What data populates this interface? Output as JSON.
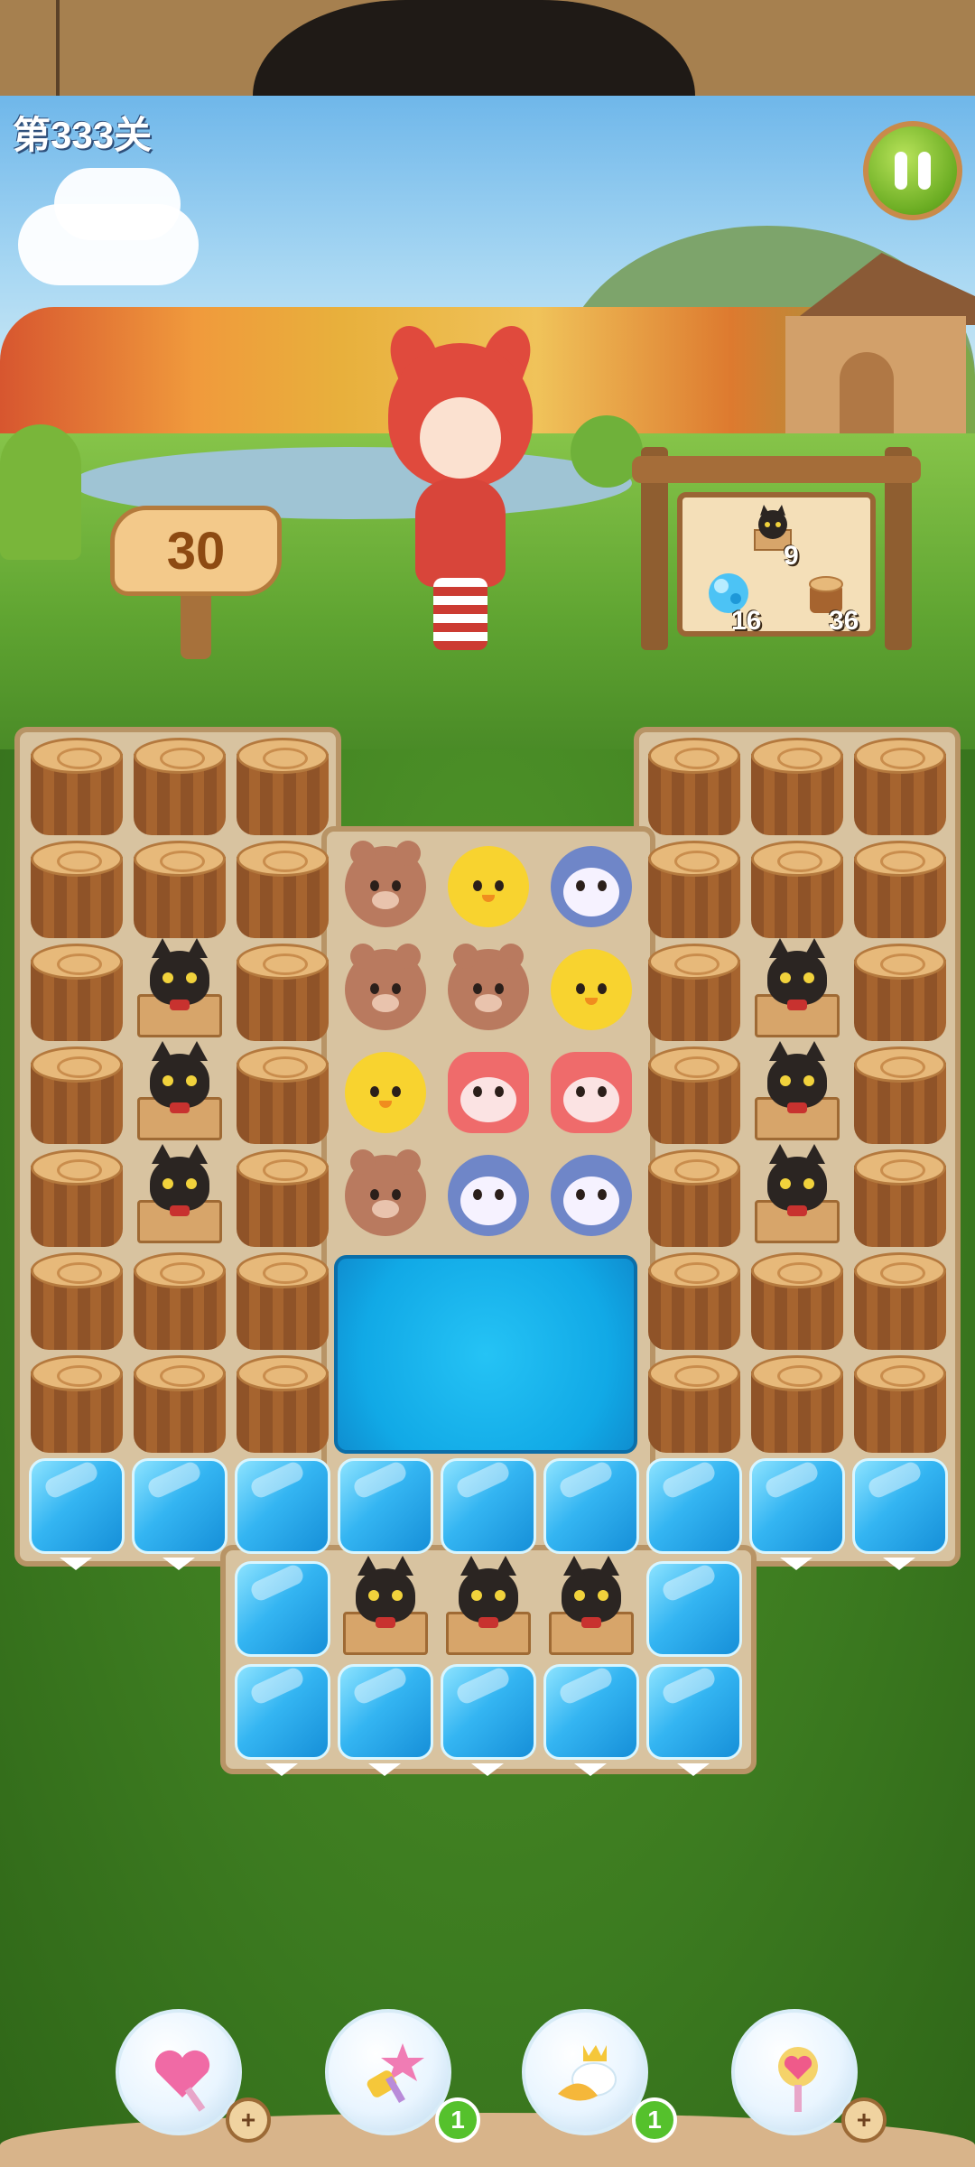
{
  "level": {
    "title": "第333关"
  },
  "moves": {
    "remaining": "30"
  },
  "goals": [
    {
      "name": "black-cat",
      "count": "9"
    },
    {
      "name": "blue-crystal",
      "count": "16"
    },
    {
      "name": "wood-stump",
      "count": "36"
    }
  ],
  "boosters": [
    {
      "name": "heart-wand",
      "badge": "+"
    },
    {
      "name": "star-hammer",
      "badge": "1"
    },
    {
      "name": "crown-cloud",
      "badge": "1"
    },
    {
      "name": "heart-scepter",
      "badge": "+"
    }
  ],
  "colors": {
    "accent_green": "#6aac22",
    "ice_blue": "#34b5f2",
    "wood": "#a6642f"
  },
  "icons": {
    "pause": "pause-icon",
    "stump": "wood-stump-icon",
    "ice": "ice-block-icon",
    "cat": "black-cat-in-box-icon"
  }
}
